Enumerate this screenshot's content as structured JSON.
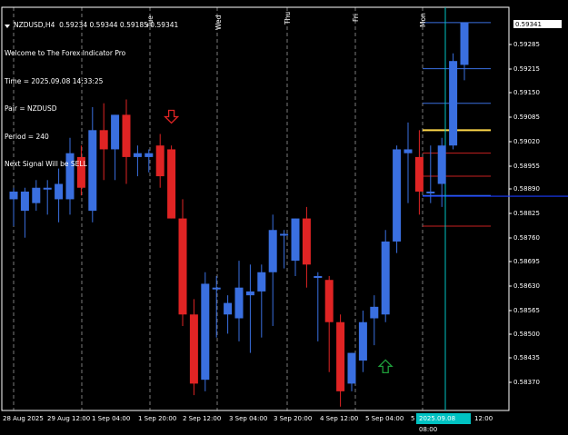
{
  "header": {
    "symbol_line": "NZDUSD,H4  0.59234 0.59344 0.59185 0.59341",
    "lines": [
      "Welcome to The Forex Indicator Pro",
      "Time = 2025.09.08 14:33:25",
      "Pair = NZDUSD",
      "Period = 240",
      "Next Signal Will be SELL"
    ]
  },
  "price_axis": {
    "labels": [
      "0.59285",
      "0.59215",
      "0.59150",
      "0.59085",
      "0.59020",
      "0.58955",
      "0.58890",
      "0.58825",
      "0.58760",
      "0.58695",
      "0.58630",
      "0.58565",
      "0.58500",
      "0.58435",
      "0.58370"
    ],
    "current_price": "0.59341"
  },
  "time_axis": {
    "labels": [
      "28 Aug 2025",
      "29 Aug 12:00",
      "1 Sep 04:00",
      "1 Sep 20:00",
      "2 Sep 12:00",
      "3 Sep 04:00",
      "3 Sep 20:00",
      "4 Sep 12:00",
      "5 Sep 04:00",
      "5",
      "12:00"
    ],
    "current_time": "2025.09.08 08:00"
  },
  "day_labels": [
    "Tue",
    "Wed",
    "Thu",
    "Fri",
    "Mon"
  ],
  "colors": {
    "bull": "#3a6fe0",
    "bear": "#e02424",
    "grid": "#ffffff",
    "level_blue": "#3a6fe0",
    "level_red": "#c82020",
    "level_yellow": "#ffd84a",
    "cursor": "#00c2c2",
    "bid_line": "#1a3cff"
  },
  "chart_data": {
    "type": "candlestick",
    "candles": [
      {
        "o": 0.5888,
        "h": 0.5891,
        "l": 0.5881,
        "c": 0.589
      },
      {
        "o": 0.5885,
        "h": 0.5891,
        "l": 0.5878,
        "c": 0.589
      },
      {
        "o": 0.5887,
        "h": 0.5893,
        "l": 0.5885,
        "c": 0.5891
      },
      {
        "o": 0.5891,
        "h": 0.5893,
        "l": 0.5884,
        "c": 0.5891
      },
      {
        "o": 0.5888,
        "h": 0.5896,
        "l": 0.5882,
        "c": 0.5892
      },
      {
        "o": 0.5888,
        "h": 0.5904,
        "l": 0.5884,
        "c": 0.59
      },
      {
        "o": 0.5899,
        "h": 0.5902,
        "l": 0.5889,
        "c": 0.5891
      },
      {
        "o": 0.5885,
        "h": 0.5912,
        "l": 0.5882,
        "c": 0.5906
      },
      {
        "o": 0.5906,
        "h": 0.5913,
        "l": 0.5893,
        "c": 0.5901
      },
      {
        "o": 0.5901,
        "h": 0.591,
        "l": 0.5893,
        "c": 0.591
      },
      {
        "o": 0.591,
        "h": 0.5914,
        "l": 0.5892,
        "c": 0.5899
      },
      {
        "o": 0.5899,
        "h": 0.5902,
        "l": 0.5894,
        "c": 0.59
      },
      {
        "o": 0.5899,
        "h": 0.5901,
        "l": 0.5895,
        "c": 0.59
      },
      {
        "o": 0.5902,
        "h": 0.5905,
        "l": 0.5891,
        "c": 0.5894
      },
      {
        "o": 0.5901,
        "h": 0.5902,
        "l": 0.5883,
        "c": 0.5883
      },
      {
        "o": 0.5883,
        "h": 0.5888,
        "l": 0.5855,
        "c": 0.5858
      },
      {
        "o": 0.5858,
        "h": 0.5862,
        "l": 0.5837,
        "c": 0.584
      },
      {
        "o": 0.5841,
        "h": 0.5869,
        "l": 0.5838,
        "c": 0.5866
      },
      {
        "o": 0.5865,
        "h": 0.5868,
        "l": 0.5852,
        "c": 0.5865
      },
      {
        "o": 0.5858,
        "h": 0.5863,
        "l": 0.5853,
        "c": 0.5861
      },
      {
        "o": 0.5857,
        "h": 0.5872,
        "l": 0.5851,
        "c": 0.5865
      },
      {
        "o": 0.5863,
        "h": 0.5871,
        "l": 0.5848,
        "c": 0.5864
      },
      {
        "o": 0.5864,
        "h": 0.5871,
        "l": 0.5852,
        "c": 0.5869
      },
      {
        "o": 0.5869,
        "h": 0.5884,
        "l": 0.5855,
        "c": 0.588
      },
      {
        "o": 0.5879,
        "h": 0.588,
        "l": 0.587,
        "c": 0.5879
      },
      {
        "o": 0.5872,
        "h": 0.5883,
        "l": 0.5868,
        "c": 0.5883
      },
      {
        "o": 0.5883,
        "h": 0.5886,
        "l": 0.5865,
        "c": 0.5871
      },
      {
        "o": 0.5868,
        "h": 0.5869,
        "l": 0.5851,
        "c": 0.5868
      },
      {
        "o": 0.5867,
        "h": 0.5868,
        "l": 0.5843,
        "c": 0.5856
      },
      {
        "o": 0.5856,
        "h": 0.5858,
        "l": 0.5834,
        "c": 0.5838
      },
      {
        "o": 0.584,
        "h": 0.5848,
        "l": 0.5838,
        "c": 0.5848
      },
      {
        "o": 0.5846,
        "h": 0.5859,
        "l": 0.5843,
        "c": 0.5856
      },
      {
        "o": 0.5857,
        "h": 0.5863,
        "l": 0.585,
        "c": 0.586
      },
      {
        "o": 0.5858,
        "h": 0.588,
        "l": 0.5856,
        "c": 0.5877
      },
      {
        "o": 0.5877,
        "h": 0.5902,
        "l": 0.5874,
        "c": 0.5901
      },
      {
        "o": 0.59,
        "h": 0.5908,
        "l": 0.5887,
        "c": 0.5901
      },
      {
        "o": 0.5899,
        "h": 0.5906,
        "l": 0.5884,
        "c": 0.589
      },
      {
        "o": 0.589,
        "h": 0.5902,
        "l": 0.5887,
        "c": 0.589
      },
      {
        "o": 0.5892,
        "h": 0.5904,
        "l": 0.5886,
        "c": 0.5902
      },
      {
        "o": 0.5902,
        "h": 0.5926,
        "l": 0.5901,
        "c": 0.5924
      },
      {
        "o": 0.5923,
        "h": 0.5934,
        "l": 0.5919,
        "c": 0.5934
      }
    ],
    "ylim": [
      0.5834,
      0.5935
    ],
    "levels": [
      {
        "price": 0.5934,
        "color": "level_blue"
      },
      {
        "price": 0.5922,
        "color": "level_blue"
      },
      {
        "price": 0.5913,
        "color": "level_blue"
      },
      {
        "price": 0.5906,
        "color": "level_yellow"
      },
      {
        "price": 0.59,
        "color": "level_red"
      },
      {
        "price": 0.5894,
        "color": "level_red"
      },
      {
        "price": 0.5889,
        "color": "level_blue"
      },
      {
        "price": 0.5881,
        "color": "level_red"
      }
    ],
    "signals": [
      {
        "type": "sell",
        "candle": 14,
        "price": 0.59095
      },
      {
        "type": "buy",
        "candle": 33,
        "price": 0.58445
      }
    ]
  }
}
